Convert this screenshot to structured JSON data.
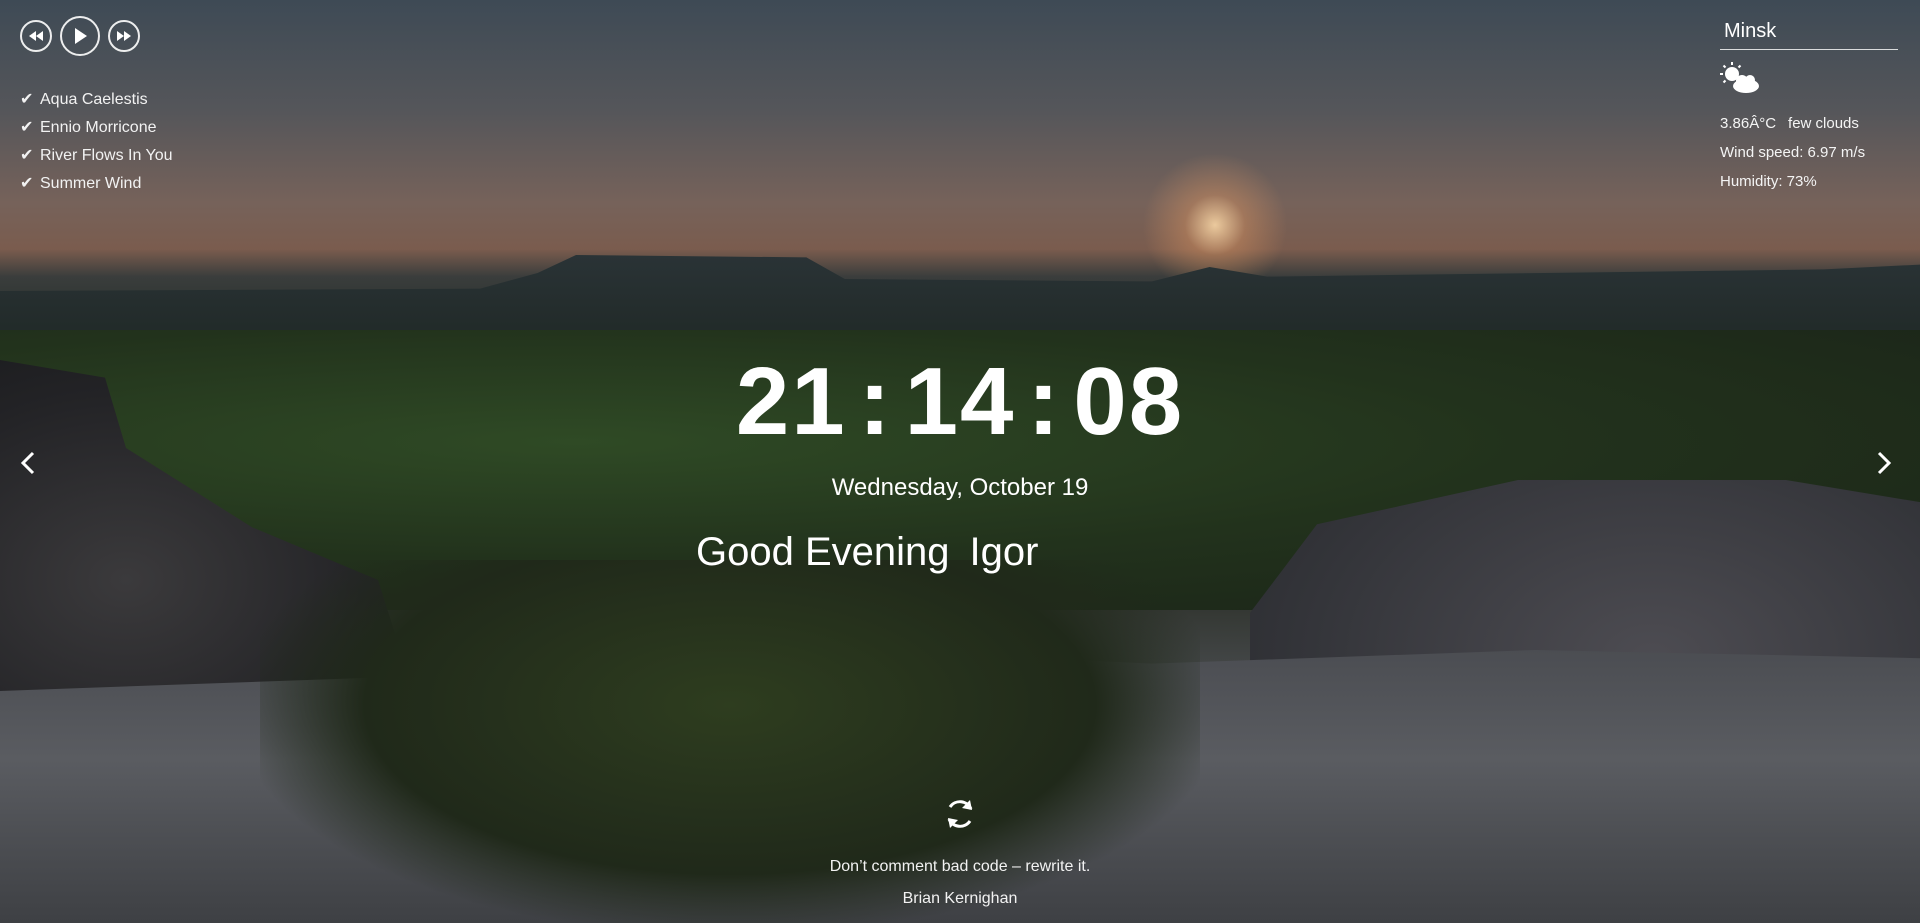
{
  "player": {
    "prev_icon": "rewind-icon",
    "play_icon": "play-icon",
    "next_icon": "fast-forward-icon"
  },
  "playlist": [
    {
      "title": "Aqua Caelestis",
      "icon": "check-icon"
    },
    {
      "title": "Ennio Morricone",
      "icon": "check-icon"
    },
    {
      "title": "River Flows In You",
      "icon": "check-icon"
    },
    {
      "title": "Summer Wind",
      "icon": "check-icon"
    }
  ],
  "weather": {
    "city": "Minsk",
    "icon": "cloud-sun-icon",
    "temperature": "3.86Â°C",
    "description": "few clouds",
    "wind": "Wind speed: 6.97 m/s",
    "humidity": "Humidity: 73%"
  },
  "clock": {
    "hours": "21",
    "minutes": "14",
    "seconds": "08",
    "separator": ":"
  },
  "date": "Wednesday, October 19",
  "greeting": {
    "text": "Good Evening",
    "name": "Igor"
  },
  "quote": {
    "text": "Don’t comment bad code – rewrite it.",
    "author": "Brian Kernighan"
  },
  "colors": {
    "text": "#ffffff"
  }
}
